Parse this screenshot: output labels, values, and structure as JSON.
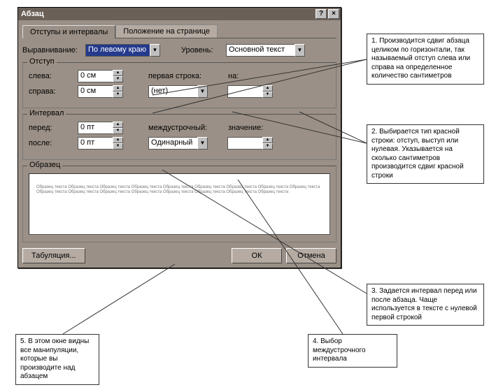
{
  "dialog": {
    "title": "Абзац",
    "tabs": {
      "indents": "Отступы и интервалы",
      "position": "Положение на странице"
    },
    "alignment_label": "Выравнивание:",
    "alignment_value": "По левому краю",
    "level_label": "Уровень:",
    "level_value": "Основной текст",
    "indent": {
      "legend": "Отступ",
      "left_label": "слева:",
      "left_value": "0 см",
      "right_label": "справа:",
      "right_value": "0 см",
      "firstline_label": "первая строка:",
      "firstline_value": "(нет)",
      "by_label": "на:",
      "by_value": ""
    },
    "spacing": {
      "legend": "Интервал",
      "before_label": "перед:",
      "before_value": "0 пт",
      "after_label": "после:",
      "after_value": "0 пт",
      "line_label": "междустрочный:",
      "line_value": "Одинарный",
      "at_label": "значение:",
      "at_value": ""
    },
    "preview_legend": "Образец",
    "preview_text": "Образец текста Образец текста Образец текста Образец текста Образец текста Образец текста Образец текста Образец текста Образец текста Образец текста Образец текста Образец текста Образец текста Образец текста Образец текста Образец текста Образец текста",
    "tabulation_btn": "Табуляция...",
    "ok_btn": "ОК",
    "cancel_btn": "Отмена"
  },
  "callouts": {
    "c1": "1. Производится сдвиг абзаца целиком по горизонтали, так называемый отступ слева или справа на определенное количество сантиметров",
    "c2": "2. Выбирается тип красной строки: отступ, выступ или нулевая. Указывается на сколько сантиметров производится сдвиг красной строки",
    "c3": "3. Задается интервал перед или после абзаца. Чаще используется в тексте с нулевой первой строкой",
    "c4": "4. Выбор междустрочного интервала",
    "c5": "5. В этом окне видны все манипуляции, которые вы производите над абзацем"
  }
}
